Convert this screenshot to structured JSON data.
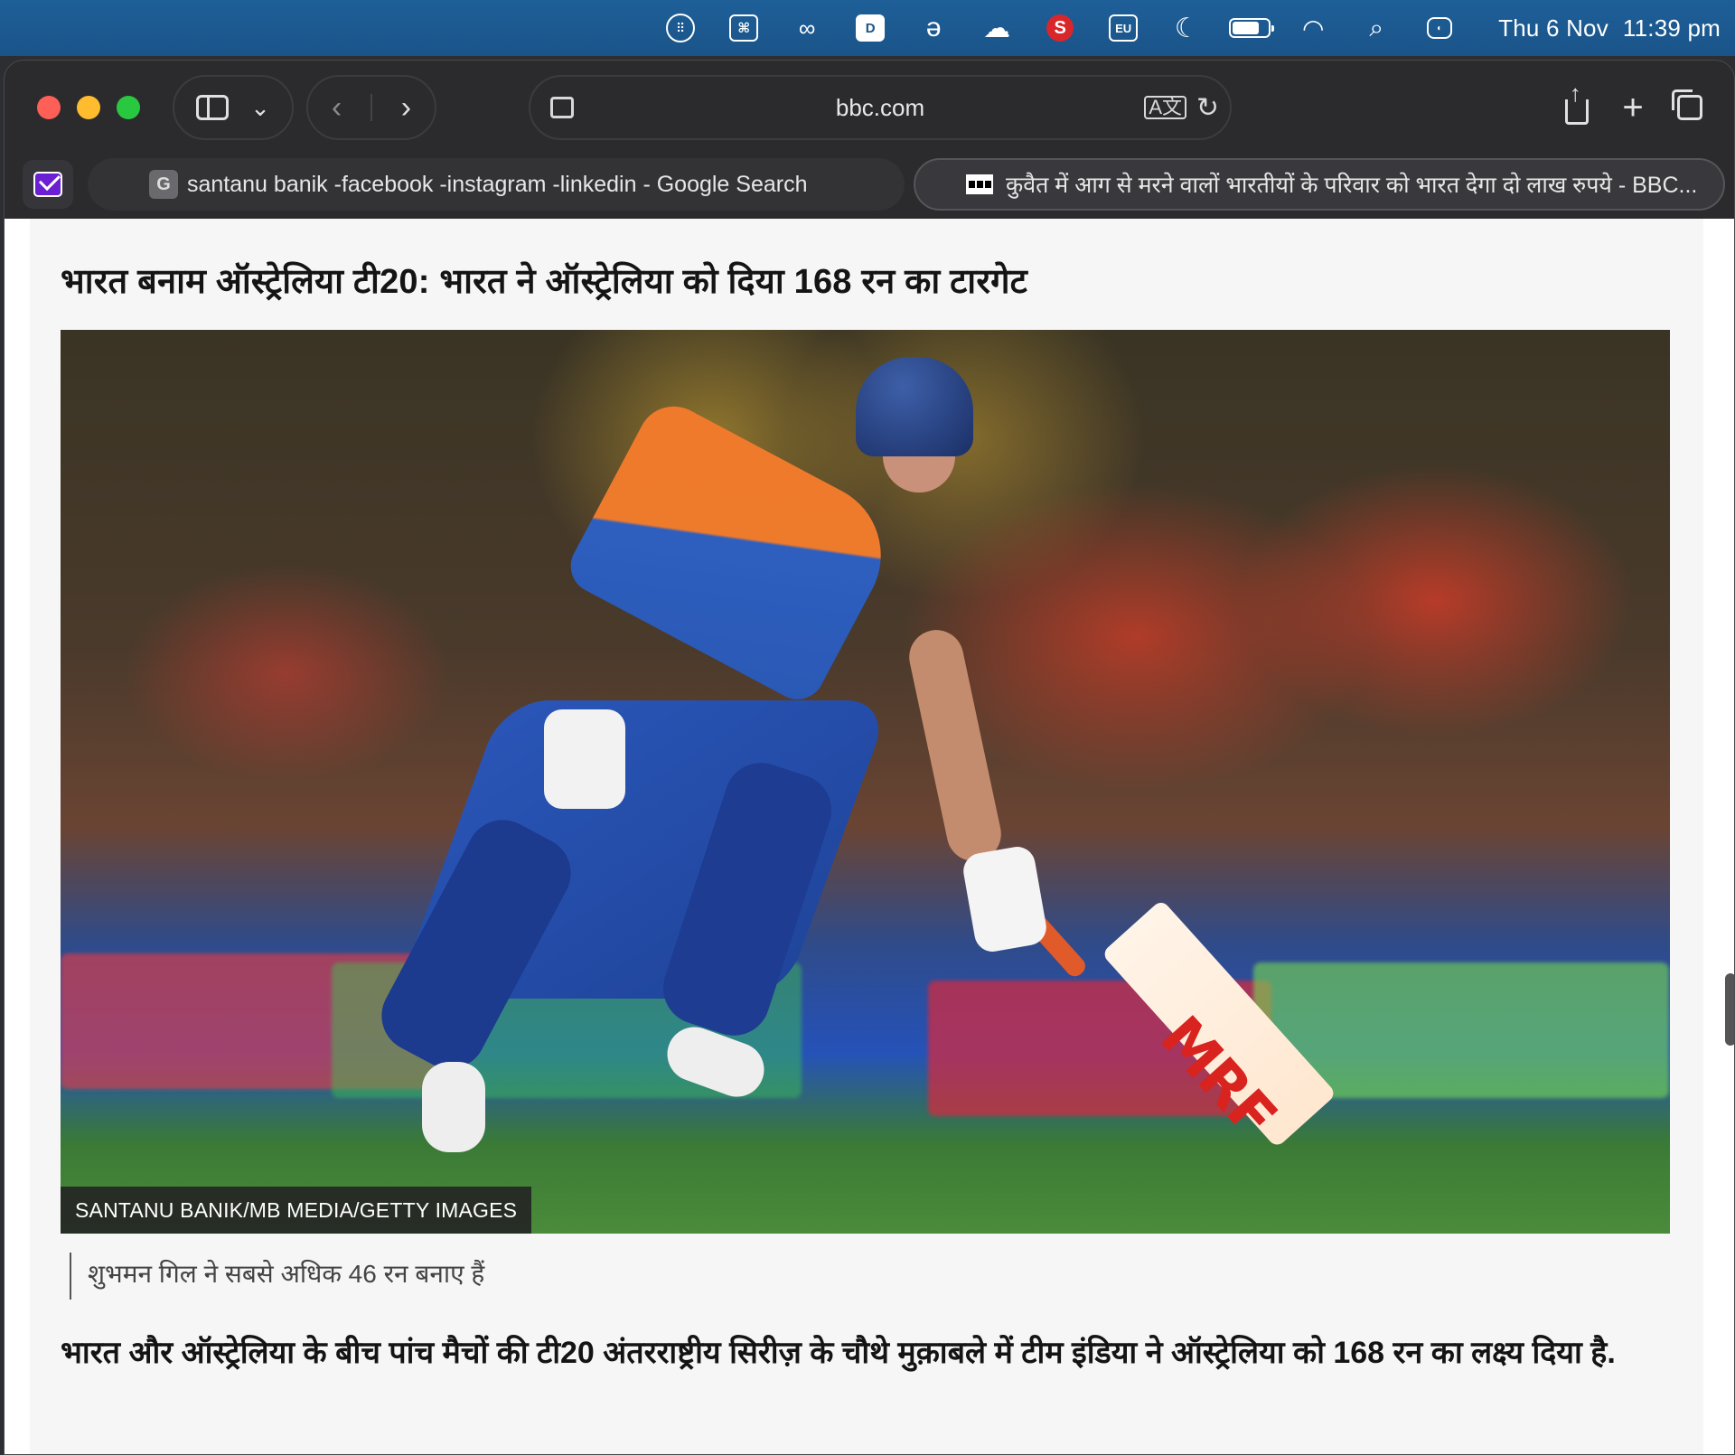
{
  "menubar": {
    "date": "Thu 6 Nov",
    "time": "11:39 pm",
    "icons": [
      "app-grid-icon",
      "command-icon",
      "creative-cloud-icon",
      "dashlane-icon",
      "edge-icon",
      "cloud-sync-icon",
      "s-app-icon",
      "eu-icon",
      "moon-icon",
      "battery-icon",
      "wifi-icon",
      "search-icon",
      "control-center-icon"
    ],
    "eu_label": "EU",
    "s_label": "S"
  },
  "browser": {
    "address": "bbc.com",
    "tabs": [
      {
        "favicon": "G",
        "title": "santanu banik -facebook -instagram -linkedin - Google Search",
        "active": false
      },
      {
        "favicon": "BBC",
        "title": "कुवैत में आग से मरने वालों भारतीयों के परिवार को भारत देगा दो लाख रुपये - BBC...",
        "active": true
      }
    ]
  },
  "article": {
    "headline": "भारत बनाम ऑस्ट्रेलिया टी20: भारत ने ऑस्ट्रेलिया को दिया 168 रन का टारगेट",
    "image_credit": "SANTANU BANIK/MB MEDIA/GETTY IMAGES",
    "bat_logo": "MRF",
    "caption": "शुभमन गिल ने सबसे अधिक 46 रन बनाए हैं",
    "body": "भारत और ऑस्ट्रेलिया के बीच पांच मैचों की टी20 अंतरराष्ट्रीय सिरीज़ के चौथे मुक़ाबले में टीम इंडिया ने ऑस्ट्रेलिया को 168 रन का लक्ष्य दिया है."
  }
}
